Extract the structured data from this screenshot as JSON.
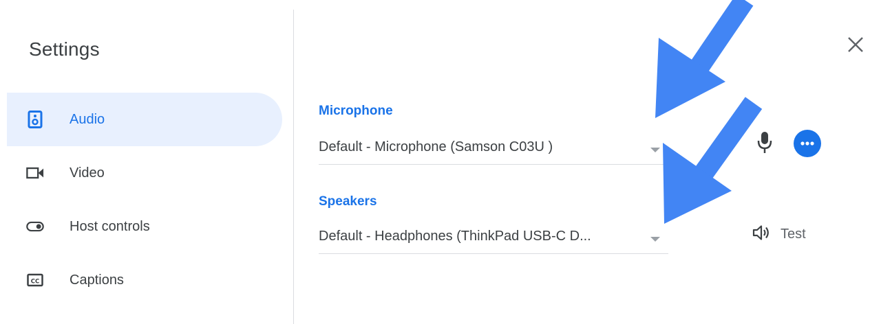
{
  "sidebar": {
    "title": "Settings",
    "items": [
      {
        "label": "Audio",
        "icon": "speaker-icon",
        "active": true
      },
      {
        "label": "Video",
        "icon": "video-camera-icon",
        "active": false
      },
      {
        "label": "Host controls",
        "icon": "toggle-icon",
        "active": false
      },
      {
        "label": "Captions",
        "icon": "closed-captions-icon",
        "active": false
      }
    ]
  },
  "audio": {
    "microphone": {
      "label": "Microphone",
      "value": "Default - Microphone (Samson C03U )"
    },
    "speakers": {
      "label": "Speakers",
      "value": "Default - Headphones (ThinkPad USB-C D...",
      "test_label": "Test"
    }
  },
  "colors": {
    "accent": "#1a73e8",
    "active_bg": "#e8f0fe",
    "annotation_arrow": "#4285f4",
    "text": "#3c4043"
  }
}
